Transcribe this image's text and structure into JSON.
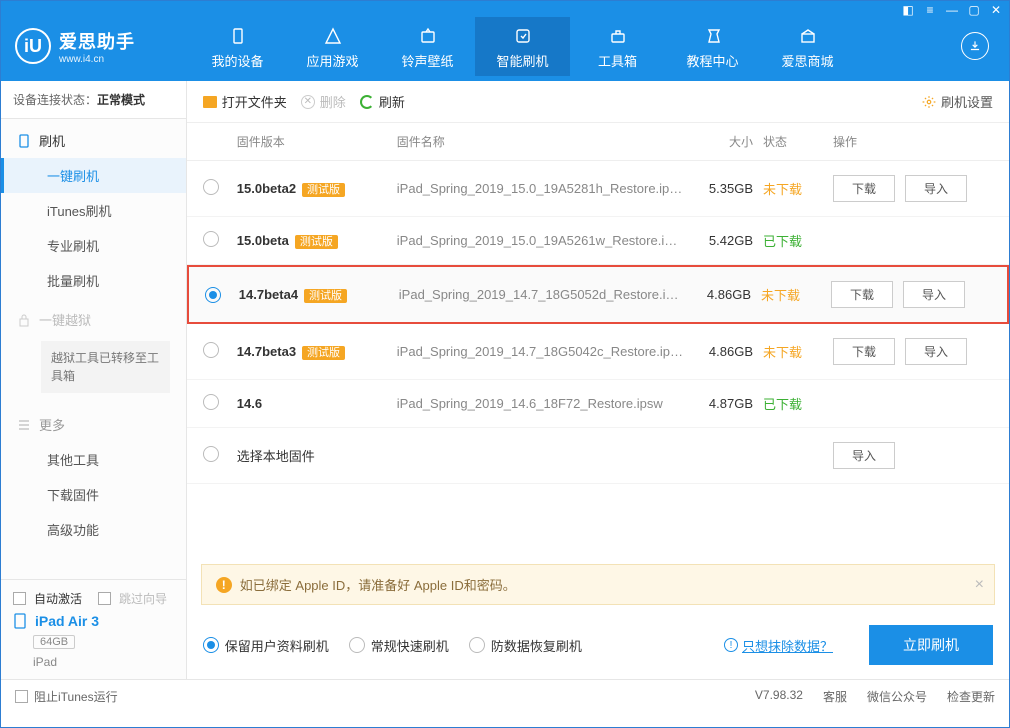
{
  "brand": {
    "title": "爱思助手",
    "subtitle": "www.i4.cn"
  },
  "nav": {
    "items": [
      {
        "label": "我的设备"
      },
      {
        "label": "应用游戏"
      },
      {
        "label": "铃声壁纸"
      },
      {
        "label": "智能刷机"
      },
      {
        "label": "工具箱"
      },
      {
        "label": "教程中心"
      },
      {
        "label": "爱思商城"
      }
    ]
  },
  "connection": {
    "label": "设备连接状态：",
    "value": "正常模式"
  },
  "sidebar": {
    "flash": {
      "head": "刷机",
      "items": [
        "一键刷机",
        "iTunes刷机",
        "专业刷机",
        "批量刷机"
      ]
    },
    "jailbreak": {
      "head": "一键越狱",
      "note": "越狱工具已转移至工具箱"
    },
    "more": {
      "head": "更多",
      "items": [
        "其他工具",
        "下载固件",
        "高级功能"
      ]
    }
  },
  "sidefoot": {
    "auto_activate": "自动激活",
    "skip_guide": "跳过向导",
    "device_name": "iPad Air 3",
    "storage": "64GB",
    "model": "iPad"
  },
  "toolbar": {
    "open_folder": "打开文件夹",
    "delete": "删除",
    "refresh": "刷新",
    "settings": "刷机设置"
  },
  "columns": {
    "version": "固件版本",
    "name": "固件名称",
    "size": "大小",
    "status": "状态",
    "action": "操作"
  },
  "status_labels": {
    "not_downloaded": "未下载",
    "downloaded": "已下载"
  },
  "buttons": {
    "download": "下载",
    "import": "导入"
  },
  "beta_tag": "测试版",
  "rows": [
    {
      "version": "15.0beta2",
      "beta": true,
      "name": "iPad_Spring_2019_15.0_19A5281h_Restore.ip…",
      "size": "5.35GB",
      "status": "not_downloaded",
      "selected": false,
      "actions": [
        "download",
        "import"
      ]
    },
    {
      "version": "15.0beta",
      "beta": true,
      "name": "iPad_Spring_2019_15.0_19A5261w_Restore.i…",
      "size": "5.42GB",
      "status": "downloaded",
      "selected": false,
      "actions": []
    },
    {
      "version": "14.7beta4",
      "beta": true,
      "name": "iPad_Spring_2019_14.7_18G5052d_Restore.i…",
      "size": "4.86GB",
      "status": "not_downloaded",
      "selected": true,
      "actions": [
        "download",
        "import"
      ],
      "highlight": true
    },
    {
      "version": "14.7beta3",
      "beta": true,
      "name": "iPad_Spring_2019_14.7_18G5042c_Restore.ip…",
      "size": "4.86GB",
      "status": "not_downloaded",
      "selected": false,
      "actions": [
        "download",
        "import"
      ]
    },
    {
      "version": "14.6",
      "beta": false,
      "name": "iPad_Spring_2019_14.6_18F72_Restore.ipsw",
      "size": "4.87GB",
      "status": "downloaded",
      "selected": false,
      "actions": []
    }
  ],
  "local_row": {
    "label": "选择本地固件"
  },
  "alert": "如已绑定 Apple ID，请准备好 Apple ID和密码。",
  "flash_options": {
    "keep_data": "保留用户资料刷机",
    "normal": "常规快速刷机",
    "anti_recovery": "防数据恢复刷机",
    "erase_link": "只想抹除数据？",
    "flash_now": "立即刷机"
  },
  "statusbar": {
    "block_itunes": "阻止iTunes运行",
    "version": "V7.98.32",
    "service": "客服",
    "wechat": "微信公众号",
    "check_update": "检查更新"
  }
}
